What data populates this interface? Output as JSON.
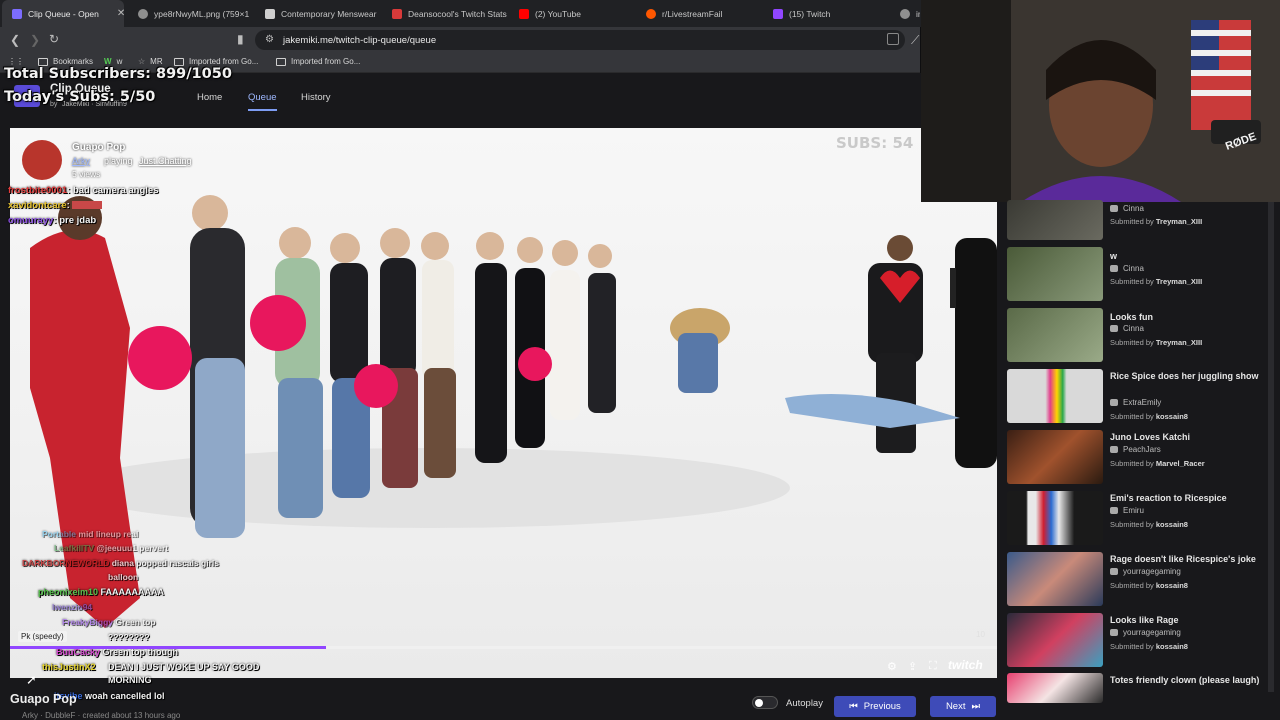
{
  "browser": {
    "tabs": [
      {
        "label": "Clip Queue - Open",
        "active": true,
        "color": "#7c6cff"
      },
      {
        "label": "ype8rNwyML.png (759×1",
        "color": "#8f8f8f"
      },
      {
        "label": "Contemporary Menswear",
        "color": "#cfcfcf"
      },
      {
        "label": "Deansocool's Twitch Stats",
        "color": "#d93a3a"
      },
      {
        "label": "(2) YouTube",
        "color": "#ff0000"
      },
      {
        "label": "r/LivestreamFail",
        "color": "#ff5700"
      },
      {
        "label": "(15) Twitch",
        "color": "#9146ff"
      },
      {
        "label": "im",
        "color": "#8f8f8f"
      }
    ],
    "url": "jakemiki.me/twitch-clip-queue/queue",
    "bookmarks": [
      {
        "label": "Bookmarks"
      },
      {
        "label": "w"
      },
      {
        "label": "MR"
      },
      {
        "label": "Imported from Go..."
      },
      {
        "label": "Imported from Go..."
      }
    ]
  },
  "app": {
    "title": "Clip Queue",
    "by_text": "by",
    "by_names": "JakeMiki · SirMuffin9",
    "nav": [
      {
        "label": "Home"
      },
      {
        "label": "Queue",
        "active": true
      },
      {
        "label": "History"
      }
    ]
  },
  "overlay": {
    "total_subscribers": "Total Subscribers: 899/1050",
    "todays_subs": "Today's Subs: 5/50",
    "subs_corner": "SUBS: 54"
  },
  "clip": {
    "channel": "Guapo Pop",
    "submitter": "Arky",
    "playing_text": "playing",
    "category": "Just Chatting",
    "views": "5 views",
    "timestamp_right": "10",
    "footer_title": "Guapo Pop",
    "footer_meta": "Arky · DubbleF · created about 13 hours ago"
  },
  "chat_top": [
    {
      "user": "frostbite0001",
      "msg": "bad camera angles",
      "color": "#e03c3c"
    },
    {
      "user": "xavidontcare",
      "msg": "",
      "color": "#e6c12e"
    },
    {
      "user": "omuurayy",
      "msg": "pre jdab",
      "color": "#8a4fe0"
    }
  ],
  "chat_bottom": [
    {
      "user": "Portable",
      "msg": "mid lineup real",
      "color": "#4fb9e8"
    },
    {
      "user": "LeafkillTV",
      "msg": "@jeeuuu1 pervert",
      "color": "#3fa34d"
    },
    {
      "user": "DARKBORNEWORLD",
      "msg": "diana popped rascals girls",
      "color": "#c42121"
    },
    {
      "user": "",
      "msg": "balloon",
      "color": "#cccccc"
    },
    {
      "user": "pheonixeim10",
      "msg": "FAAAAAAAAA",
      "color": "#58c24f"
    },
    {
      "user": "lwenzio94",
      "msg": "",
      "color": "#7a5ccd"
    },
    {
      "user": "Pk (speedy)",
      "msg": "????????",
      "color": "#bfbfbf"
    },
    {
      "user": "FreakyBiggy",
      "msg": "Green top",
      "color": "#9a5de8"
    },
    {
      "user": "BuuCacky",
      "msg": "Green top though",
      "color": "#d64bd0"
    },
    {
      "user": "thisJustinX2",
      "msg": "DEAN I JUST WOKE UP SAY GOOD MORNING",
      "color": "#e6d42e"
    },
    {
      "user": "itsvibe",
      "msg": "woah cancelled lol",
      "color": "#3c6ee0"
    }
  ],
  "controls": {
    "autoplay_label": "Autoplay",
    "previous_label": "Previous",
    "next_label": "Next",
    "twitch_logo": "twitch"
  },
  "queue": [
    {
      "title": "",
      "channel": "Cinna",
      "submitter": "Treyman_XIII"
    },
    {
      "title": "w",
      "channel": "Cinna",
      "submitter": "Treyman_XIII"
    },
    {
      "title": "Looks fun",
      "channel": "Cinna",
      "submitter": "Treyman_XIII"
    },
    {
      "title": "Rice Spice does her juggling show",
      "channel": "ExtraEmily",
      "submitter": "kossain8"
    },
    {
      "title": "Juno Loves Katchi",
      "channel": "PeachJars",
      "submitter": "Marvel_Racer"
    },
    {
      "title": "Emi's reaction to Ricespice",
      "channel": "Emiru",
      "submitter": "kossain8"
    },
    {
      "title": "Rage doesn't like Ricespice's joke",
      "channel": "yourragegaming",
      "submitter": "kossain8"
    },
    {
      "title": "Looks like Rage",
      "channel": "yourragegaming",
      "submitter": "kossain8"
    },
    {
      "title": "Totes friendly clown (please laugh)",
      "channel": "",
      "submitter": ""
    }
  ],
  "queue_submitted_prefix": "Submitted by",
  "colors": {
    "accent": "#3e4bb8",
    "twitch_purple": "#9146ff"
  }
}
